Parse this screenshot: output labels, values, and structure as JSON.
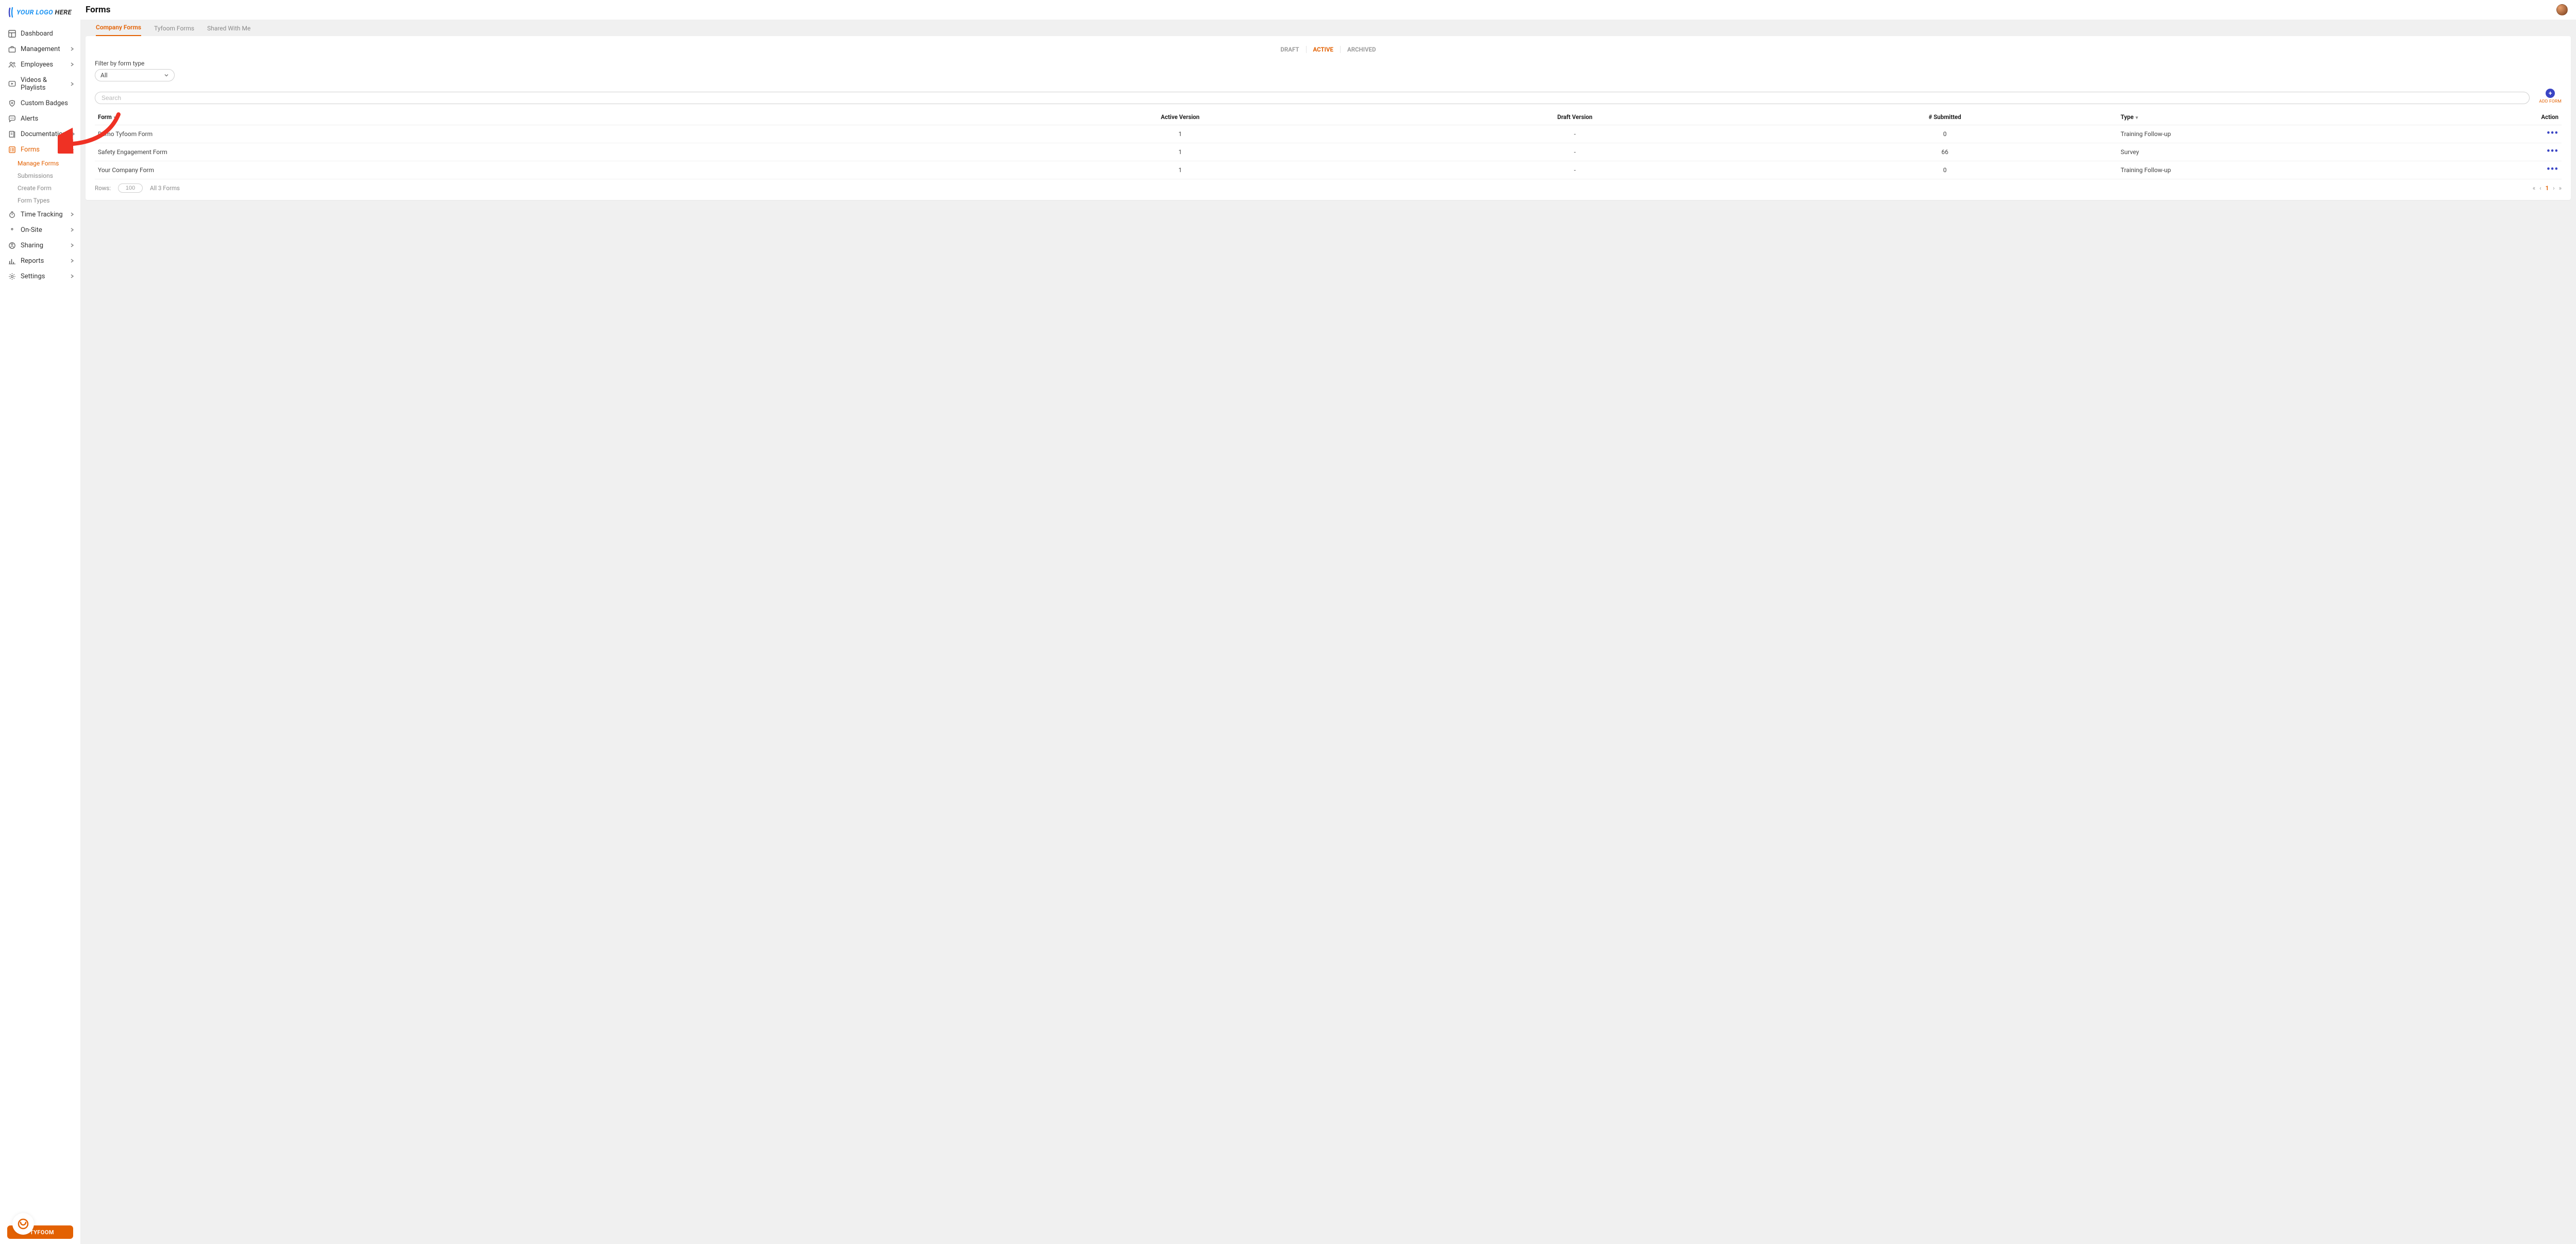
{
  "page_title": "Forms",
  "logo": {
    "text_blue": "YOUR LOGO",
    "text_dark": " HERE",
    "sub": ""
  },
  "sidebar": {
    "items": [
      {
        "label": "Dashboard",
        "icon": "dashboard-icon",
        "expandable": false
      },
      {
        "label": "Management",
        "icon": "briefcase-icon",
        "expandable": true
      },
      {
        "label": "Employees",
        "icon": "users-icon",
        "expandable": true
      },
      {
        "label": "Videos & Playlists",
        "icon": "play-icon",
        "expandable": true
      },
      {
        "label": "Custom Badges",
        "icon": "shield-icon",
        "expandable": false
      },
      {
        "label": "Alerts",
        "icon": "chat-icon",
        "expandable": false
      },
      {
        "label": "Documentation",
        "icon": "doc-icon",
        "expandable": true
      },
      {
        "label": "Forms",
        "icon": "form-icon",
        "expandable": true,
        "active": true,
        "children": [
          {
            "label": "Manage Forms",
            "active": true
          },
          {
            "label": "Submissions",
            "active": false
          },
          {
            "label": "Create Form",
            "active": false
          },
          {
            "label": "Form Types",
            "active": false
          }
        ]
      },
      {
        "label": "Time Tracking",
        "icon": "timer-icon",
        "expandable": true
      },
      {
        "label": "On-Site",
        "icon": "pin-icon",
        "expandable": true
      },
      {
        "label": "Sharing",
        "icon": "share-icon",
        "expandable": true
      },
      {
        "label": "Reports",
        "icon": "chart-icon",
        "expandable": true
      },
      {
        "label": "Settings",
        "icon": "gear-icon",
        "expandable": true
      }
    ],
    "brand": "TYFOOM"
  },
  "main": {
    "tabs": [
      {
        "label": "Company Forms",
        "active": true
      },
      {
        "label": "Tyfoom Forms",
        "active": false
      },
      {
        "label": "Shared With Me",
        "active": false
      }
    ],
    "status_tabs": [
      {
        "label": "DRAFT",
        "active": false
      },
      {
        "label": "ACTIVE",
        "active": true
      },
      {
        "label": "ARCHIVED",
        "active": false
      }
    ],
    "filter_label": "Filter by form type",
    "filter_value": "All",
    "search_placeholder": "Search",
    "add_form_label": "ADD FORM",
    "columns": {
      "form": "Form",
      "active_version": "Active Version",
      "draft_version": "Draft Version",
      "submitted": "# Submitted",
      "type": "Type",
      "action": "Action"
    },
    "rows": [
      {
        "form": "Demo Tyfoom Form",
        "active_version": "1",
        "draft_version": "-",
        "submitted": "0",
        "type": "Training Follow-up"
      },
      {
        "form": "Safety Engagement Form",
        "active_version": "1",
        "draft_version": "-",
        "submitted": "66",
        "type": "Survey"
      },
      {
        "form": "Your Company Form",
        "active_version": "1",
        "draft_version": "-",
        "submitted": "0",
        "type": "Training Follow-up"
      }
    ],
    "footer": {
      "rows_label": "Rows:",
      "rows_value": "100",
      "count_text": "All 3 Forms",
      "page_number": "1"
    }
  }
}
